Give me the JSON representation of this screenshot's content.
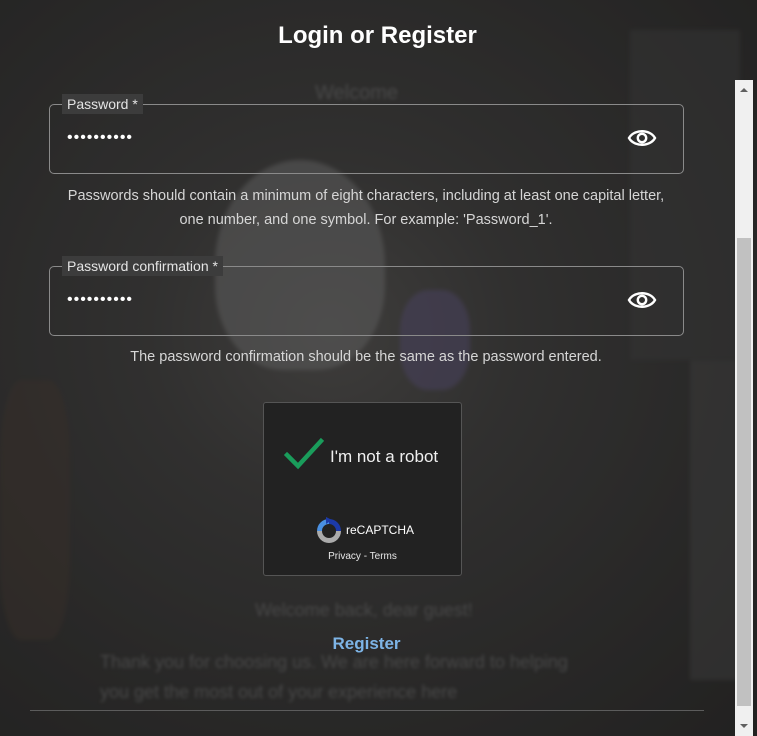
{
  "modal": {
    "title": "Login or Register",
    "password": {
      "label": "Password *",
      "value": "••••••••••",
      "icon": "eye-icon"
    },
    "password_hint": "Passwords should contain a minimum of eight characters, including at least one capital letter, one number, and one symbol. For example: 'Password_1'.",
    "confirmation": {
      "label": "Password confirmation *",
      "value": "••••••••••",
      "icon": "eye-icon"
    },
    "confirmation_hint": "The password confirmation should be the same as the password entered.",
    "captcha": {
      "label": "I'm not a robot",
      "brand": "reCAPTCHA",
      "links": "Privacy - Terms",
      "checked": true,
      "check_color": "#1a9c5b"
    },
    "register_label": "Register",
    "accent_color": "#7db4e6"
  },
  "background": {
    "heading": "Welcome",
    "welcome": "Welcome back, dear guest!",
    "line1": "Thank you for choosing us. We are here forward to helping",
    "line2": "you get the most out of your experience here"
  }
}
